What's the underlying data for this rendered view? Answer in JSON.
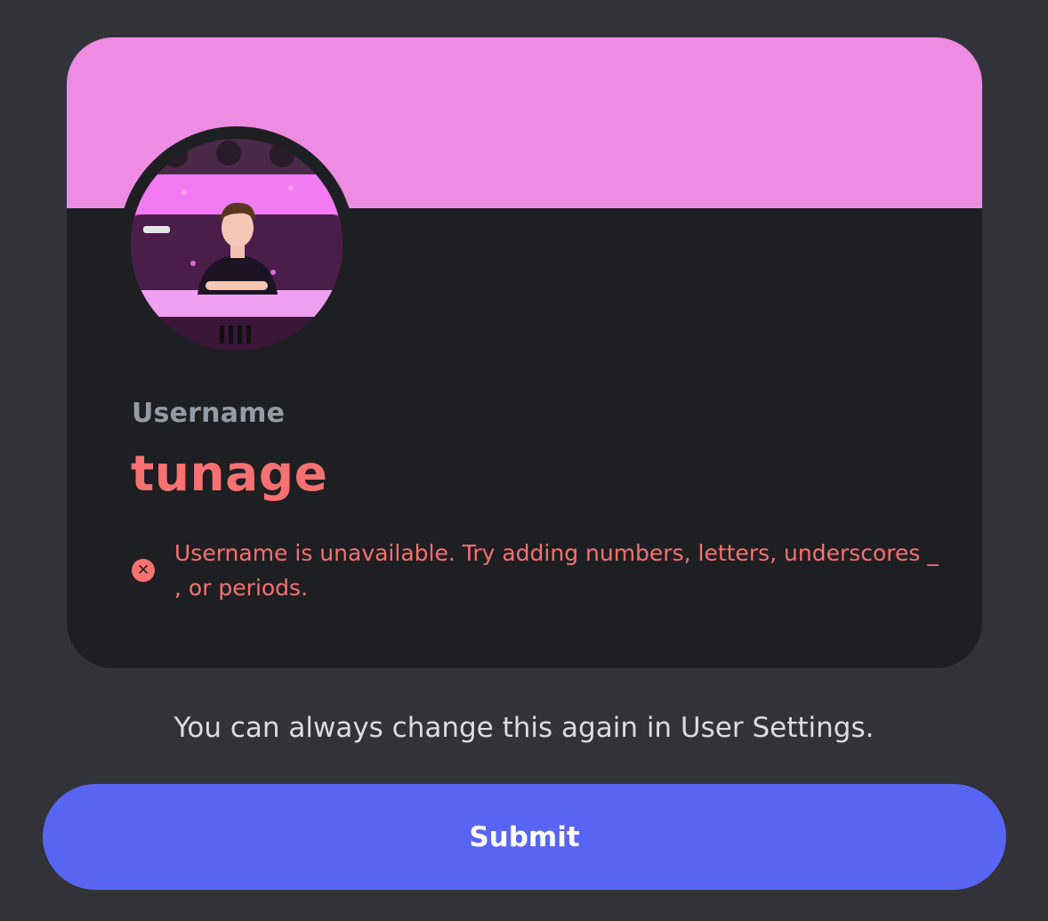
{
  "colors": {
    "page_background": "#313338",
    "card_background": "#1e1f22",
    "banner": "#ee8ce3",
    "error": "#f87171",
    "primary_button": "#5865f2"
  },
  "profile": {
    "label": "Username",
    "username": "tunage",
    "avatar_icon": "avatar-image"
  },
  "error": {
    "icon": "error-circle-x-icon",
    "glyph": "✕",
    "message": "Username is unavailable. Try adding numbers, letters, underscores _ , or periods."
  },
  "hint": "You can always change this again in User Settings.",
  "submit_label": "Submit"
}
